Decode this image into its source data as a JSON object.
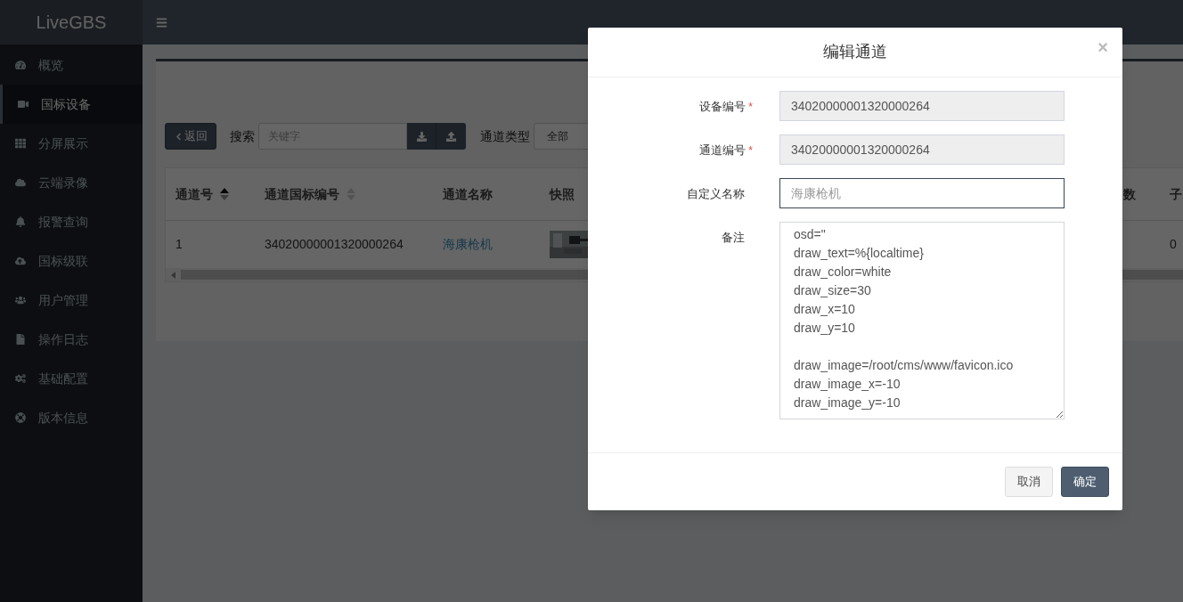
{
  "sidebar": {
    "logo": "LiveGBS",
    "items": [
      {
        "label": "概览",
        "selected": false
      },
      {
        "label": "国标设备",
        "selected": true
      },
      {
        "label": "分屏展示",
        "selected": false
      },
      {
        "label": "云端录像",
        "selected": false
      },
      {
        "label": "报警查询",
        "selected": false
      },
      {
        "label": "国标级联",
        "selected": false
      },
      {
        "label": "用户管理",
        "selected": false
      },
      {
        "label": "操作日志",
        "selected": false
      },
      {
        "label": "基础配置",
        "selected": false
      },
      {
        "label": "版本信息",
        "selected": false
      }
    ]
  },
  "toolbar": {
    "back_button": "返回",
    "search_label": "搜索",
    "search_placeholder": "关键字",
    "type_label": "通道类型",
    "type_value": "全部"
  },
  "table": {
    "columns": [
      {
        "label": "通道号",
        "sorted": true
      },
      {
        "label": "通道国标编号",
        "sorted": false
      },
      {
        "label": "通道名称"
      },
      {
        "label": "快照"
      },
      {
        "label": "数"
      },
      {
        "label": "子"
      }
    ],
    "rows": [
      {
        "channel_no": "1",
        "gb_id": "34020000001320000264",
        "name": "海康枪机",
        "column_6": "0"
      }
    ]
  },
  "dialog": {
    "title": "编辑通道",
    "close": "×",
    "fields": [
      {
        "kind": "readonly",
        "label": "设备编号",
        "required_mark": "*",
        "value": "34020000001320000264"
      },
      {
        "kind": "readonly",
        "label": "通道编号",
        "required_mark": "*",
        "value": "34020000001320000264"
      },
      {
        "kind": "input",
        "label": "自定义名称",
        "placeholder": "海康枪机",
        "focused": true
      },
      {
        "kind": "textarea",
        "label": "备注",
        "value": "osd=\"\ndraw_text=%{localtime}\ndraw_color=white\ndraw_size=30\ndraw_x=10\ndraw_y=10\n\ndraw_image=/root/cms/www/favicon.ico\ndraw_image_x=-10\ndraw_image_y=-10"
      }
    ],
    "buttons": [
      {
        "label": "取消",
        "kind": "default"
      },
      {
        "label": "确定",
        "kind": "primary"
      }
    ]
  }
}
